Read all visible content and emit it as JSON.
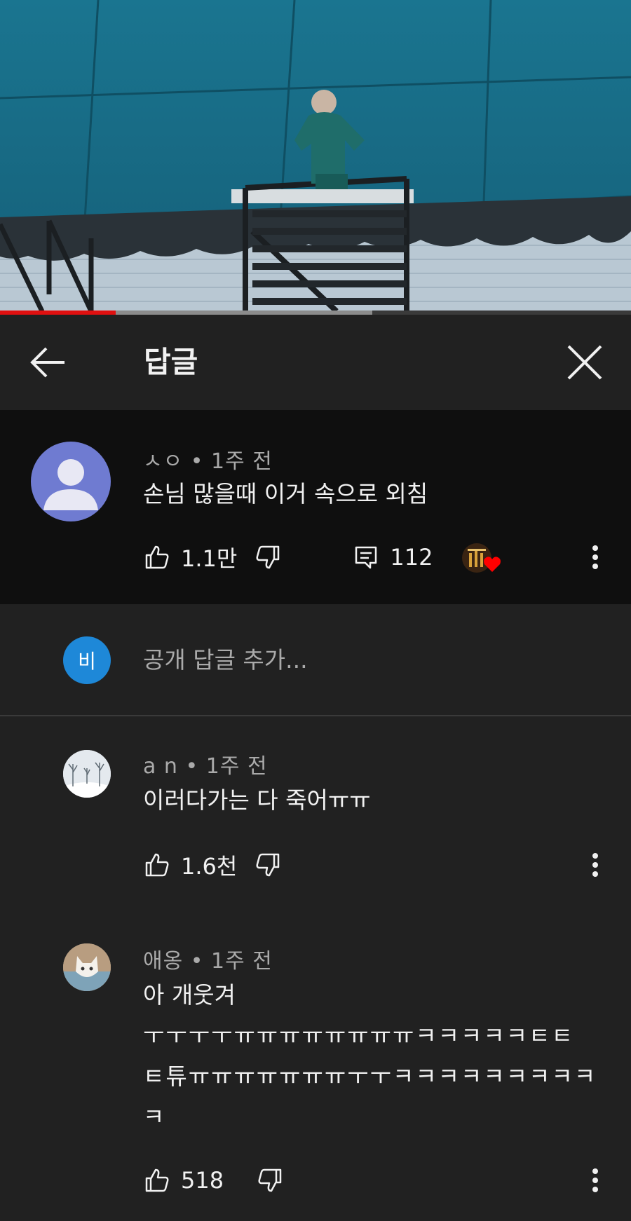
{
  "video": {
    "progress_played": 0.183,
    "progress_buffered": 0.59
  },
  "header": {
    "title": "답글",
    "back_icon": "arrow-left-icon",
    "close_icon": "close-icon"
  },
  "parent_comment": {
    "author": "ㅅㅇ",
    "time": "1주 전",
    "text": "손님 많을때 이거 속으로 외침",
    "likes": "1.1만",
    "replies": "112",
    "creator_heart": true
  },
  "reply_box": {
    "avatar_letter": "비",
    "placeholder": "공개 답글 추가..."
  },
  "replies": [
    {
      "author": "a n",
      "time": "1주 전",
      "lines": [
        "이러다가는 다 죽어ㅠㅠ"
      ],
      "likes": "1.6천"
    },
    {
      "author": "애옹",
      "time": "1주 전",
      "lines": [
        "아 개웃겨",
        "ㅜㅜㅜㅜㅠㅠㅠㅠㅠㅠㅠㅠㅋㅋㅋㅋㅋㅌㅌ",
        "ㅌ튜ㅠㅠㅠㅠㅠㅠㅠㅜㅜㅋㅋㅋㅋㅋㅋㅋㅋㅋ",
        "ㅋ"
      ],
      "likes": "518"
    }
  ],
  "colors": {
    "background": "#212121",
    "parent_background": "#0f0f0f",
    "progress_red": "#e01010",
    "my_avatar": "#1e88d8"
  }
}
